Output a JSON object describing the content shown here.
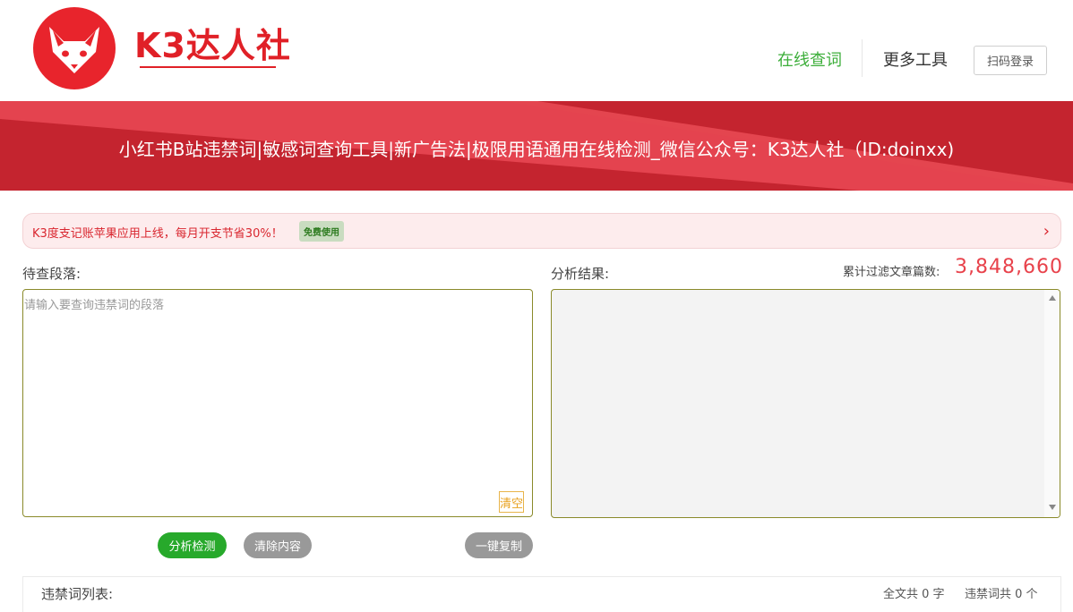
{
  "header": {
    "logo_text": "K3达人社",
    "nav": [
      {
        "label": "在线查词",
        "active": true
      },
      {
        "label": "更多工具",
        "active": false
      }
    ],
    "login_label": "扫码登录"
  },
  "banner": {
    "title": "小红书B站违禁词|敏感词查询工具|新广告法|极限用语通用在线检测_微信公众号：K3达人社（ID:doinxx)"
  },
  "promo": {
    "text": "K3度支记账苹果应用上线，每月开支节省30%！",
    "badge": "免费使用",
    "arrow": "›"
  },
  "input": {
    "label": "待查段落:",
    "placeholder": "请输入要查询违禁词的段落",
    "value": "",
    "clear_label": "清空"
  },
  "result": {
    "label": "分析结果:",
    "count_label": "累计过滤文章篇数:",
    "count_value": "3,848,660"
  },
  "buttons": {
    "analyze": "分析检测",
    "clear_content": "清除内容",
    "copy": "一键复制"
  },
  "word_list": {
    "title": "违禁词列表:",
    "total_chars": "全文共 0 字",
    "banned_count": "违禁词共 0 个"
  },
  "colors": {
    "brand_red": "#e02027",
    "banner_red": "#c4242f",
    "nav_active_green": "#3cae3a",
    "analyze_green": "#27a92b",
    "counter_red": "#e8424b"
  }
}
